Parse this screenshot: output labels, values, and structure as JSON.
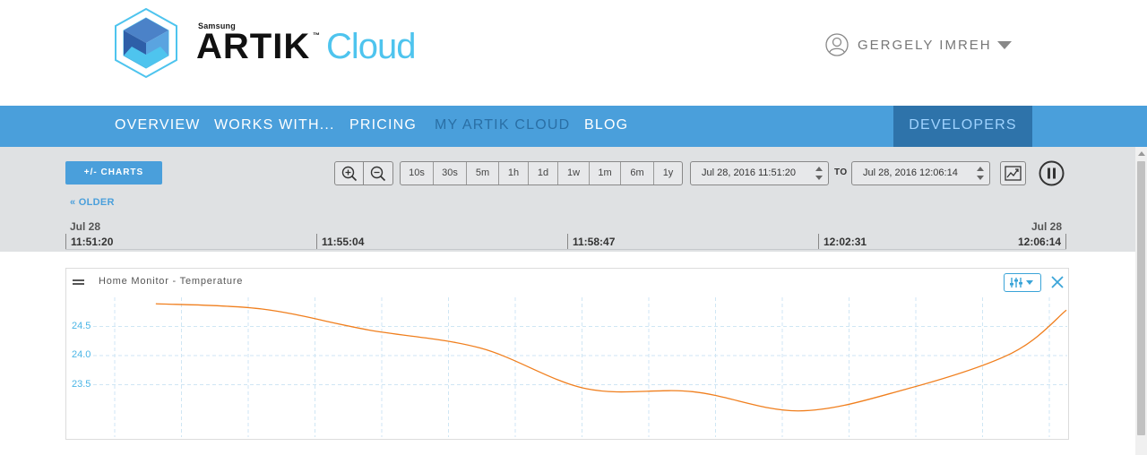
{
  "header": {
    "logo": {
      "brand_small": "Samsung",
      "brand": "ARTIK",
      "trademark": "™",
      "product": "Cloud"
    },
    "user": {
      "name": "GERGELY IMREH",
      "icon": "user-icon"
    }
  },
  "nav": {
    "items": [
      {
        "label": "OVERVIEW",
        "active": false
      },
      {
        "label": "WORKS WITH...",
        "active": false
      },
      {
        "label": "PRICING",
        "active": false
      },
      {
        "label": "MY ARTIK CLOUD",
        "active": true
      },
      {
        "label": "BLOG",
        "active": false
      }
    ],
    "developers": "DEVELOPERS"
  },
  "toolbar": {
    "charts_button": "+/- CHARTS",
    "zoom_in_icon": "zoom-in-icon",
    "zoom_out_icon": "zoom-out-icon",
    "ranges": [
      "10s",
      "30s",
      "5m",
      "1h",
      "1d",
      "1w",
      "1m",
      "6m",
      "1y"
    ],
    "from": "Jul 28, 2016 11:51:20",
    "to_label": "TO",
    "to": "Jul 28, 2016 12:06:14",
    "export_icon": "chart-export-icon",
    "pause_icon": "pause-icon"
  },
  "timeline": {
    "older_link": "« OLDER",
    "start_date": "Jul 28",
    "end_date": "Jul 28",
    "ticks": [
      "11:51:20",
      "11:55:04",
      "11:58:47",
      "12:02:31",
      "12:06:14"
    ]
  },
  "colors": {
    "nav_bg": "#4a9fdb",
    "nav_active": "#2a6fa5",
    "developers_bg": "#2e73aa",
    "line": "#f07f1e",
    "axis_label": "#4ab5e6",
    "grid": "#cfe6f4"
  },
  "chart": {
    "title": "Home Monitor - Temperature",
    "settings_icon": "sliders-icon",
    "close_icon": "close-icon",
    "drag_icon": "drag-handle-icon"
  },
  "chart_data": {
    "type": "line",
    "title": "Home Monitor - Temperature",
    "xlabel": "",
    "ylabel": "",
    "ylim": [
      22.6,
      25.0
    ],
    "yticks": [
      23.5,
      24.0,
      24.5
    ],
    "grid": true,
    "x": [
      "11:52:40",
      "11:54:15",
      "11:55:50",
      "11:57:30",
      "11:59:05",
      "12:00:40",
      "12:02:15",
      "12:03:50",
      "12:05:25",
      "12:06:14"
    ],
    "series": [
      {
        "values": [
          24.89,
          24.8,
          24.44,
          24.13,
          23.43,
          23.38,
          23.05,
          23.42,
          24.04,
          24.78
        ]
      }
    ]
  }
}
